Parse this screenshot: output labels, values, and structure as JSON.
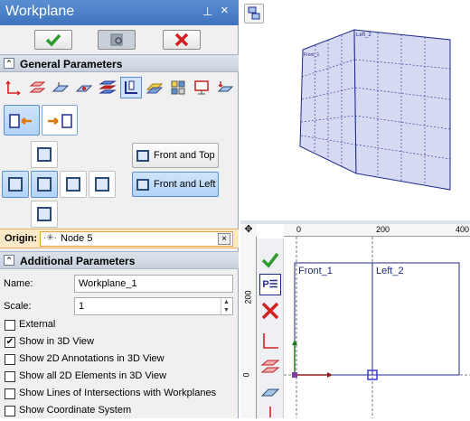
{
  "panel": {
    "title": "Workplane",
    "pin_glyph": "⊥",
    "close_glyph": "×",
    "ok_icon": "check-icon",
    "preview_icon": "preview-icon",
    "cancel_icon": "cancel-icon",
    "general_section": "General Parameters",
    "additional_section": "Additional Parameters",
    "view_buttons": {
      "front_and_top": "Front and Top",
      "front_and_left": "Front and Left"
    },
    "origin": {
      "label": "Origin:",
      "value": "Node 5"
    },
    "name": {
      "label": "Name:",
      "value": "Workplane_1"
    },
    "scale": {
      "label": "Scale:",
      "value": "1"
    },
    "checkboxes": [
      {
        "label": "External",
        "checked": false
      },
      {
        "label": "Show in 3D View",
        "checked": true
      },
      {
        "label": "Show 2D Annotations in 3D View",
        "checked": false
      },
      {
        "label": "Show all 2D Elements in 3D View",
        "checked": false
      },
      {
        "label": "Show Lines of Intersections with Workplanes",
        "checked": false
      },
      {
        "label": "Show Coordinate System",
        "checked": false
      }
    ]
  },
  "view3d": {
    "plane_label_left": "Left_2",
    "plane_label_front": "Front_1"
  },
  "view2d": {
    "ruler_top": [
      "0",
      "200",
      "400"
    ],
    "ruler_left": [
      "200",
      "0"
    ],
    "rect_front_label": "Front_1",
    "rect_left_label": "Left_2",
    "toolbar_p_label": "P☰"
  },
  "colors": {
    "accent": "#3f72bd",
    "ok_green": "#2e9b2e",
    "cancel_red": "#d42020",
    "plane_fill": "#d6d9f2",
    "plane_stroke": "#1e2a8c"
  }
}
